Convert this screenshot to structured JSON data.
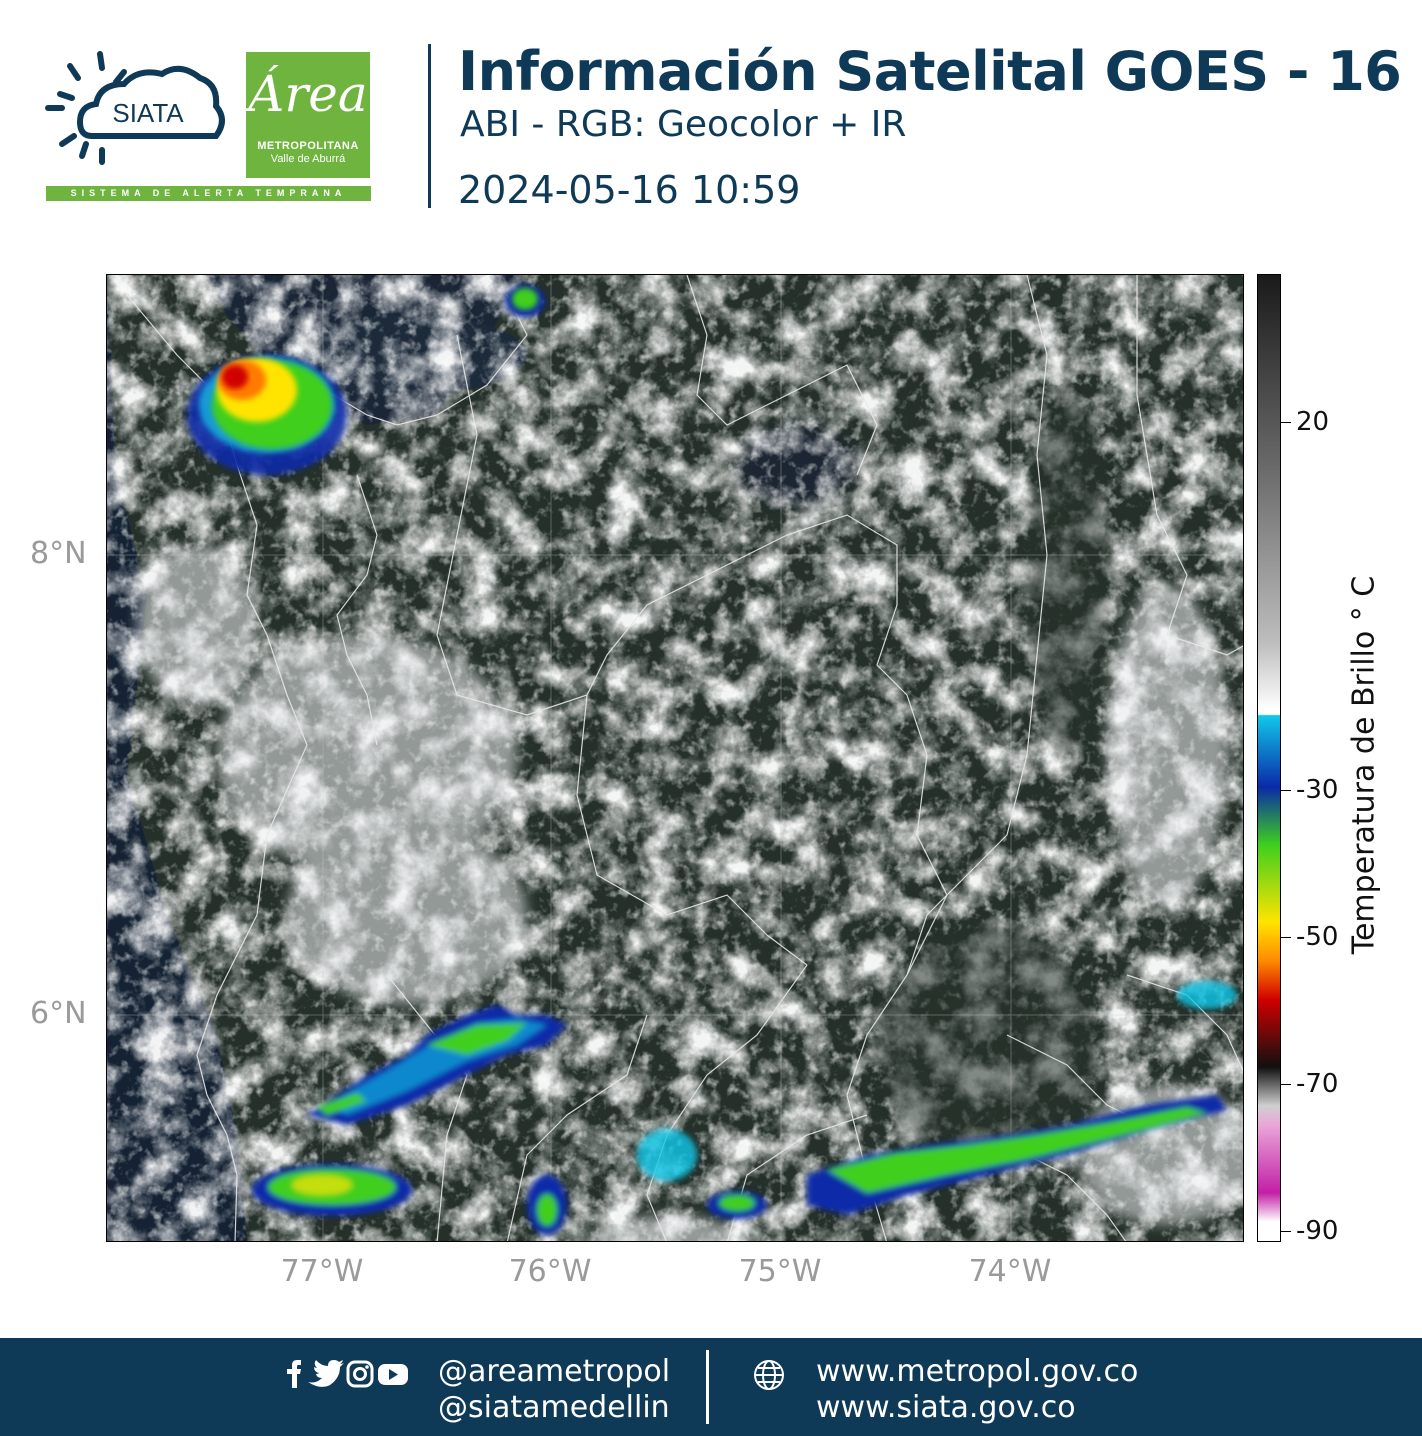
{
  "header": {
    "siata_logo_text": "SIATA",
    "area_logo_script": "Área",
    "area_logo_line1": "METROPOLITANA",
    "area_logo_line2": "Valle de Aburrá",
    "siata_tagline": "SISTEMA DE ALERTA TEMPRANA",
    "title": "Información Satelital GOES - 16",
    "subtitle": "ABI - RGB: Geocolor + IR",
    "datetime": "2024-05-16 10:59"
  },
  "map": {
    "y_ticks": [
      "8°N",
      "6°N"
    ],
    "x_ticks": [
      "77°W",
      "76°W",
      "75°W",
      "74°W"
    ],
    "gridlines": true
  },
  "colorbar": {
    "title": "Temperatura de Brillo  ° C",
    "tick_labels": [
      "20",
      "-30",
      "-50",
      "-70",
      "-90"
    ],
    "colors": {
      "warm_gray": "#1a1a1a",
      "light": "#ffffff",
      "cyan": "#12c8ea",
      "blue": "#0a2aa8",
      "green": "#3fcf1e",
      "yellow": "#ffe400",
      "red": "#d00000",
      "black": "#101010",
      "magenta": "#c21fa6"
    }
  },
  "footer": {
    "handle1": "@areametropol",
    "handle2": "@siatamedellin",
    "web1": "www.metropol.gov.co",
    "web2": "www.siata.gov.co",
    "icons": [
      "facebook-icon",
      "twitter-icon",
      "instagram-icon",
      "youtube-icon",
      "globe-icon"
    ]
  }
}
